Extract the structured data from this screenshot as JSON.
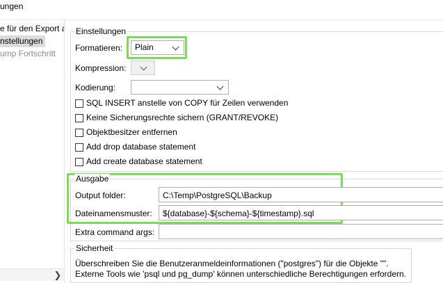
{
  "window": {
    "title": "ungen"
  },
  "nav": {
    "items": [
      {
        "label": "e für den Export a"
      },
      {
        "label": "nstellungen"
      },
      {
        "label": "ump Fortschritt"
      }
    ]
  },
  "settings": {
    "group_title": "Einstellungen",
    "format_label": "Formatieren:",
    "format_value": "Plain",
    "compression_label": "Kompression:",
    "compression_value": "",
    "encoding_label": "Kodierung:",
    "encoding_value": "",
    "checkboxes": [
      {
        "label": "SQL INSERT anstelle von COPY für Zeilen verwenden",
        "checked": false
      },
      {
        "label": "Keine Sicherungsrechte sichern (GRANT/REVOKE)",
        "checked": false
      },
      {
        "label": "Objektbesitzer entfernen",
        "checked": false
      },
      {
        "label": "Add drop database statement",
        "checked": false
      },
      {
        "label": "Add create database statement",
        "checked": false
      }
    ]
  },
  "output": {
    "group_title": "Ausgabe",
    "folder_label": "Output folder:",
    "folder_value": "C:\\Temp\\PostgreSQL\\Backup",
    "pattern_label": "Dateinamensmuster:",
    "pattern_value": "${database}-${schema}-${timestamp}.sql",
    "extra_label": "Extra command args:",
    "extra_value": ""
  },
  "security": {
    "group_title": "Sicherheit",
    "line1": "Überschreiben Sie die Benutzeranmeldeinformationen (\"postgres\") für die Objekte \"\".",
    "line2": "Externe Tools wie 'psql und pg_dump' können unterschiedliche Berechtigungen erfordern."
  },
  "colors": {
    "highlight": "#7ed957",
    "selection": "#dcdcdc"
  },
  "icons": {
    "combo_arrow": "chevron-down-icon",
    "scroll_right": "chevron-right-icon"
  }
}
